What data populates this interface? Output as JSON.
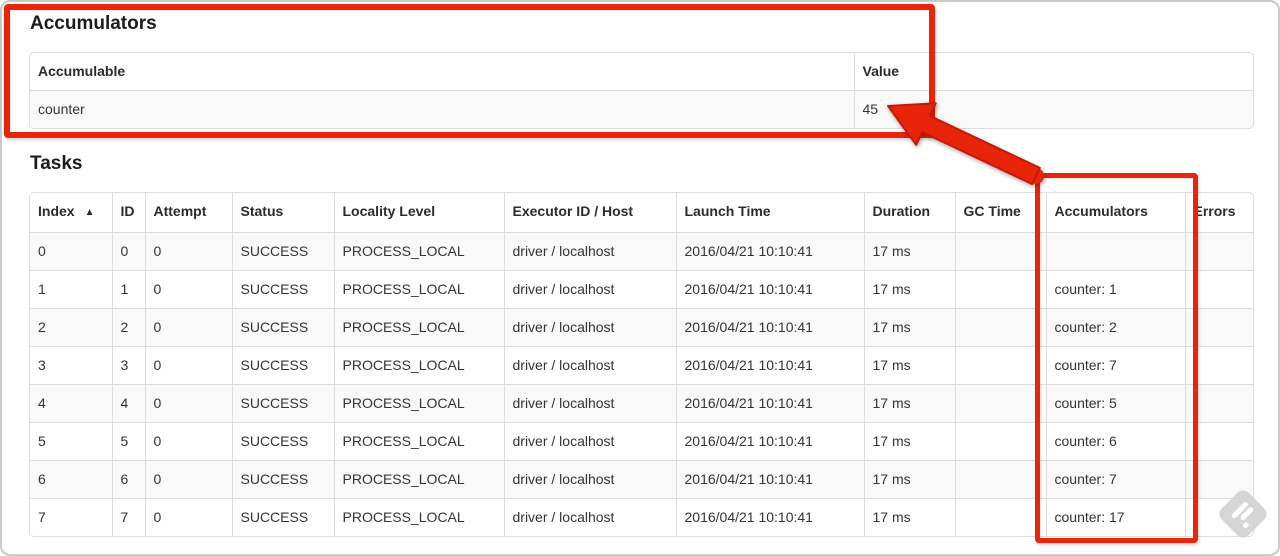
{
  "annotation_color": "#e8240b",
  "accumulators": {
    "title": "Accumulators",
    "columns": [
      "Accumulable",
      "Value"
    ],
    "rows": [
      [
        "counter",
        "45"
      ]
    ]
  },
  "tasks": {
    "title": "Tasks",
    "columns": [
      "Index",
      "ID",
      "Attempt",
      "Status",
      "Locality Level",
      "Executor ID / Host",
      "Launch Time",
      "Duration",
      "GC Time",
      "Accumulators",
      "Errors"
    ],
    "sort": {
      "column": "Index",
      "direction": "ascending",
      "icon": "▲"
    },
    "rows": [
      [
        "0",
        "0",
        "0",
        "SUCCESS",
        "PROCESS_LOCAL",
        "driver / localhost",
        "2016/04/21 10:10:41",
        "17 ms",
        "",
        "",
        ""
      ],
      [
        "1",
        "1",
        "0",
        "SUCCESS",
        "PROCESS_LOCAL",
        "driver / localhost",
        "2016/04/21 10:10:41",
        "17 ms",
        "",
        "counter: 1",
        ""
      ],
      [
        "2",
        "2",
        "0",
        "SUCCESS",
        "PROCESS_LOCAL",
        "driver / localhost",
        "2016/04/21 10:10:41",
        "17 ms",
        "",
        "counter: 2",
        ""
      ],
      [
        "3",
        "3",
        "0",
        "SUCCESS",
        "PROCESS_LOCAL",
        "driver / localhost",
        "2016/04/21 10:10:41",
        "17 ms",
        "",
        "counter: 7",
        ""
      ],
      [
        "4",
        "4",
        "0",
        "SUCCESS",
        "PROCESS_LOCAL",
        "driver / localhost",
        "2016/04/21 10:10:41",
        "17 ms",
        "",
        "counter: 5",
        ""
      ],
      [
        "5",
        "5",
        "0",
        "SUCCESS",
        "PROCESS_LOCAL",
        "driver / localhost",
        "2016/04/21 10:10:41",
        "17 ms",
        "",
        "counter: 6",
        ""
      ],
      [
        "6",
        "6",
        "0",
        "SUCCESS",
        "PROCESS_LOCAL",
        "driver / localhost",
        "2016/04/21 10:10:41",
        "17 ms",
        "",
        "counter: 7",
        ""
      ],
      [
        "7",
        "7",
        "0",
        "SUCCESS",
        "PROCESS_LOCAL",
        "driver / localhost",
        "2016/04/21 10:10:41",
        "17 ms",
        "",
        "counter: 17",
        ""
      ]
    ]
  }
}
